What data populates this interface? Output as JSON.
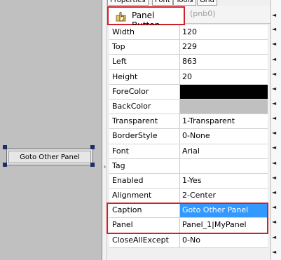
{
  "canvas": {
    "button_label": "Goto Other Panel"
  },
  "tabs": [
    "Properties",
    "Font",
    "Tools",
    "Grid"
  ],
  "header": {
    "title": "Panel Button",
    "subtitle": "(pnb0)",
    "icon": "hand-pointer-icon"
  },
  "properties": [
    {
      "name": "Width",
      "value": "120"
    },
    {
      "name": "Top",
      "value": "229"
    },
    {
      "name": "Left",
      "value": "863"
    },
    {
      "name": "Height",
      "value": "20"
    },
    {
      "name": "ForeColor",
      "value": "",
      "color": "#000000"
    },
    {
      "name": "BackColor",
      "value": "",
      "color": "#c0c0c0"
    },
    {
      "name": "Transparent",
      "value": "1-Transparent"
    },
    {
      "name": "BorderStyle",
      "value": "0-None"
    },
    {
      "name": "Font",
      "value": "Arial"
    },
    {
      "name": "Tag",
      "value": ""
    },
    {
      "name": "Enabled",
      "value": "1-Yes"
    },
    {
      "name": "Alignment",
      "value": "2-Center"
    },
    {
      "name": "Caption",
      "value": "Goto Other Panel",
      "selected": true
    },
    {
      "name": "Panel",
      "value": "Panel_1|MyPanel"
    },
    {
      "name": "CloseAllExcept",
      "value": "0-No"
    }
  ],
  "colors": {
    "highlight_box": "#d0202a",
    "selection": "#3399ff",
    "canvas": "#c0c0c0"
  }
}
